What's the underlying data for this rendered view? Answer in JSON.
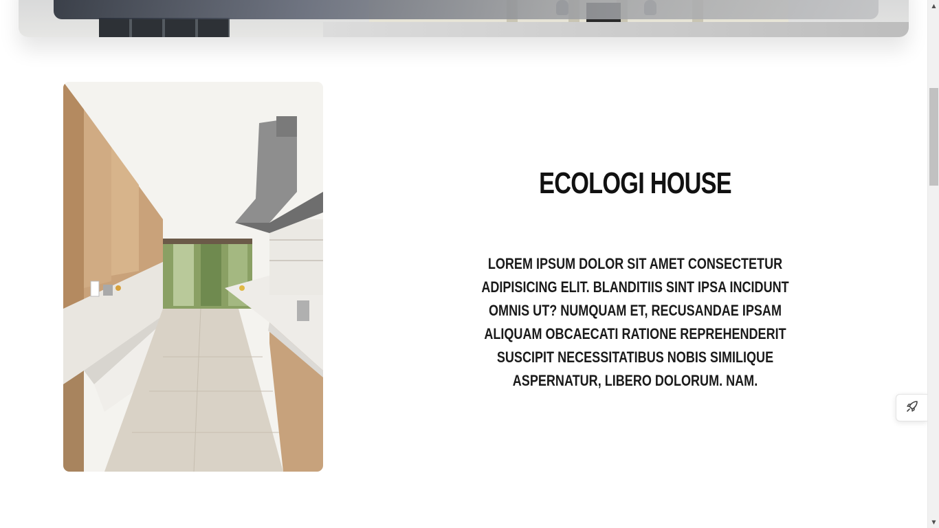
{
  "section": {
    "title": "ECOLOGI HOUSE",
    "body": "LOREM IPSUM DOLOR SIT AMET CONSECTETUR ADIPISICING ELIT. BLANDITIIS SINT IPSA INCIDUNT OMNIS UT? NUMQUAM ET, RECUSANDAE IPSAM ALIQUAM OBCAECATI RATIONE REPREHENDERIT SUSCIPIT NECESSITATIBUS NOBIS SIMILIQUE ASPERNATUR, LIBERO DOLORUM. NAM."
  },
  "floating_button": {
    "icon": "rocket-icon"
  },
  "scrollbar": {
    "up_glyph": "▲",
    "down_glyph": "▼"
  },
  "colors": {
    "text": "#111111",
    "background": "#ffffff"
  }
}
